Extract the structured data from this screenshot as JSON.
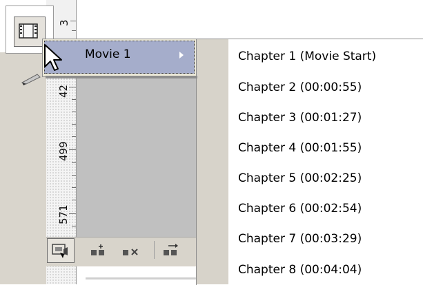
{
  "ruler": {
    "labels": [
      "3",
      "42",
      "499",
      "571"
    ]
  },
  "menu": {
    "item_label": "Movie 1"
  },
  "chapters": [
    "Chapter 1 (Movie Start)",
    "Chapter 2 (00:00:55)",
    "Chapter 3 (00:01:27)",
    "Chapter 4 (00:01:55)",
    "Chapter 5 (00:02:25)",
    "Chapter 6 (00:02:54)",
    "Chapter 7 (00:03:29)",
    "Chapter 8 (00:04:04)"
  ],
  "icons": {
    "toolbar": "chapter-view-icon",
    "bottom": [
      "capture-icon",
      "add-chapter-icon",
      "delete-chapter-icon",
      "move-chapter-icon"
    ],
    "cursor": "mouse-pointer-icon",
    "pencil": "pencil-icon"
  }
}
